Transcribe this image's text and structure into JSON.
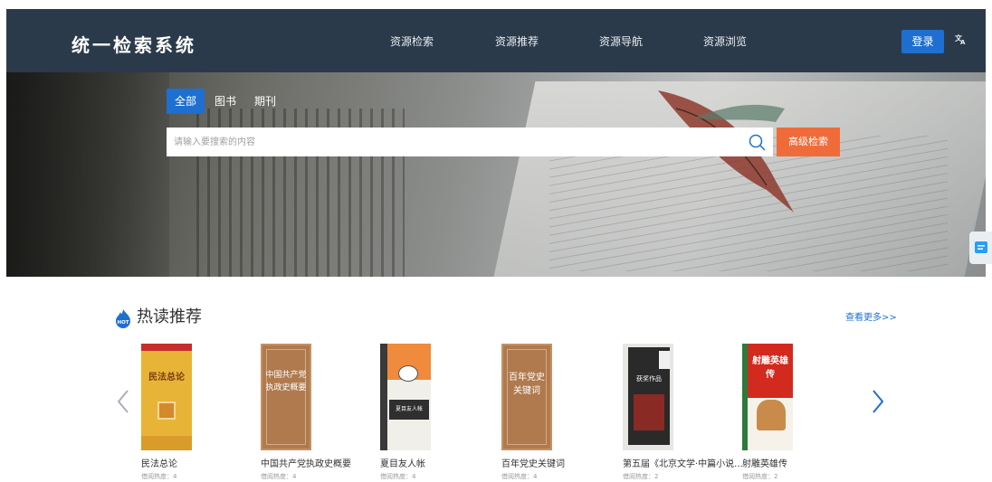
{
  "header": {
    "logo": "统一检索系统",
    "nav": [
      "资源检索",
      "资源推荐",
      "资源导航",
      "资源浏览"
    ],
    "login_label": "登录",
    "lang_icon": "translate-icon"
  },
  "search": {
    "tabs": [
      "全部",
      "图书",
      "期刊"
    ],
    "active_tab": "全部",
    "placeholder": "请输入要搜索的内容",
    "advanced_label": "高级检索",
    "accent": "#1e6fd0",
    "advanced_color": "#ef6c3a"
  },
  "hot": {
    "title": "热读推荐",
    "icon_label": "HOT",
    "more_label": "查看更多>>",
    "books": [
      {
        "title": "民法总论",
        "meta": "借阅热度：4",
        "cover_text": "民法总论"
      },
      {
        "title": "中国共产党执政史概要",
        "meta": "借阅热度：4",
        "cover_text": "中国共产党执政史概要"
      },
      {
        "title": "夏目友人帐",
        "meta": "借阅热度：4",
        "cover_text": "夏目友人帐"
      },
      {
        "title": "百年党史关键词",
        "meta": "借阅热度：4",
        "cover_text": "百年党史关键词"
      },
      {
        "title": "第五届《北京文学·中篇小说...",
        "meta": "借阅热度：2",
        "cover_text": "获奖作品"
      },
      {
        "title": "射雕英雄传",
        "meta": "借阅热度：2",
        "cover_text": "射雕英雄传"
      }
    ]
  }
}
